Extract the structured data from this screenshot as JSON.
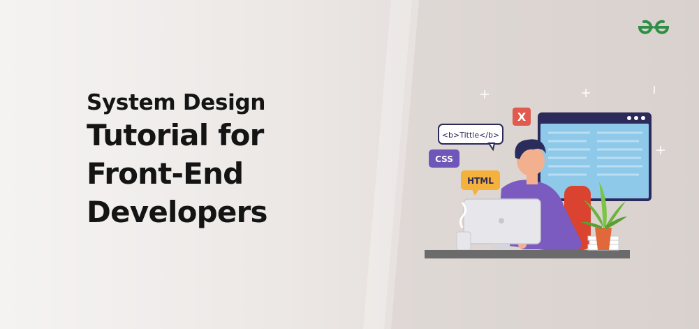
{
  "banner": {
    "title_lines": [
      "System Design",
      "Tutorial for",
      "Front-End",
      "Developers"
    ],
    "logo_icon": "geeksforgeeks-logo-icon",
    "colors": {
      "brand_green": "#2f8d46",
      "title": "#141414",
      "shirt": "#7b5bbf",
      "screen": "#8ec9ea",
      "badge_css": "#6e57b8",
      "badge_html": "#f4b13c",
      "badge_x": "#e05a4e"
    },
    "bubbles": {
      "b_tag": "<b>Tittle</b>",
      "css": "CSS",
      "html": "HTML",
      "close": "X"
    }
  }
}
